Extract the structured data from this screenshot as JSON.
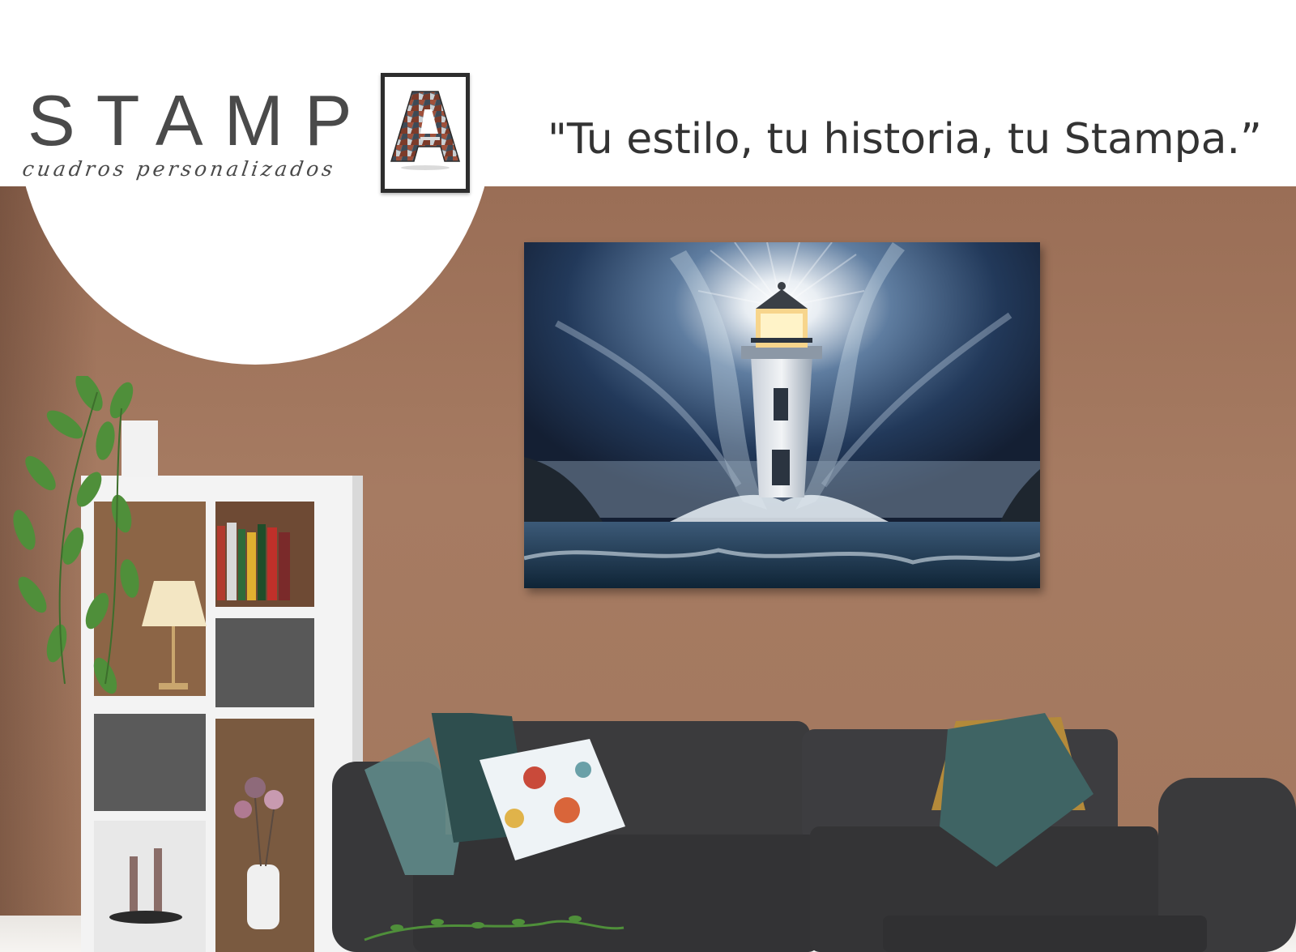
{
  "brand": {
    "name": "STAMP",
    "letter": "A",
    "subtitle": "cuadros personalizados"
  },
  "tagline": "\"Tu estilo, tu historia, tu Stampa.”",
  "colors": {
    "wall": "#a67b62",
    "text": "#4a4a4a",
    "sofa": "#3a3a3c",
    "sky": "#1c2f4a",
    "shelf": "#f2f2f2"
  },
  "scene": {
    "painting_subject": "lighthouse",
    "furniture": [
      "sofa",
      "bookshelf",
      "plant",
      "lamp",
      "cushions"
    ]
  }
}
